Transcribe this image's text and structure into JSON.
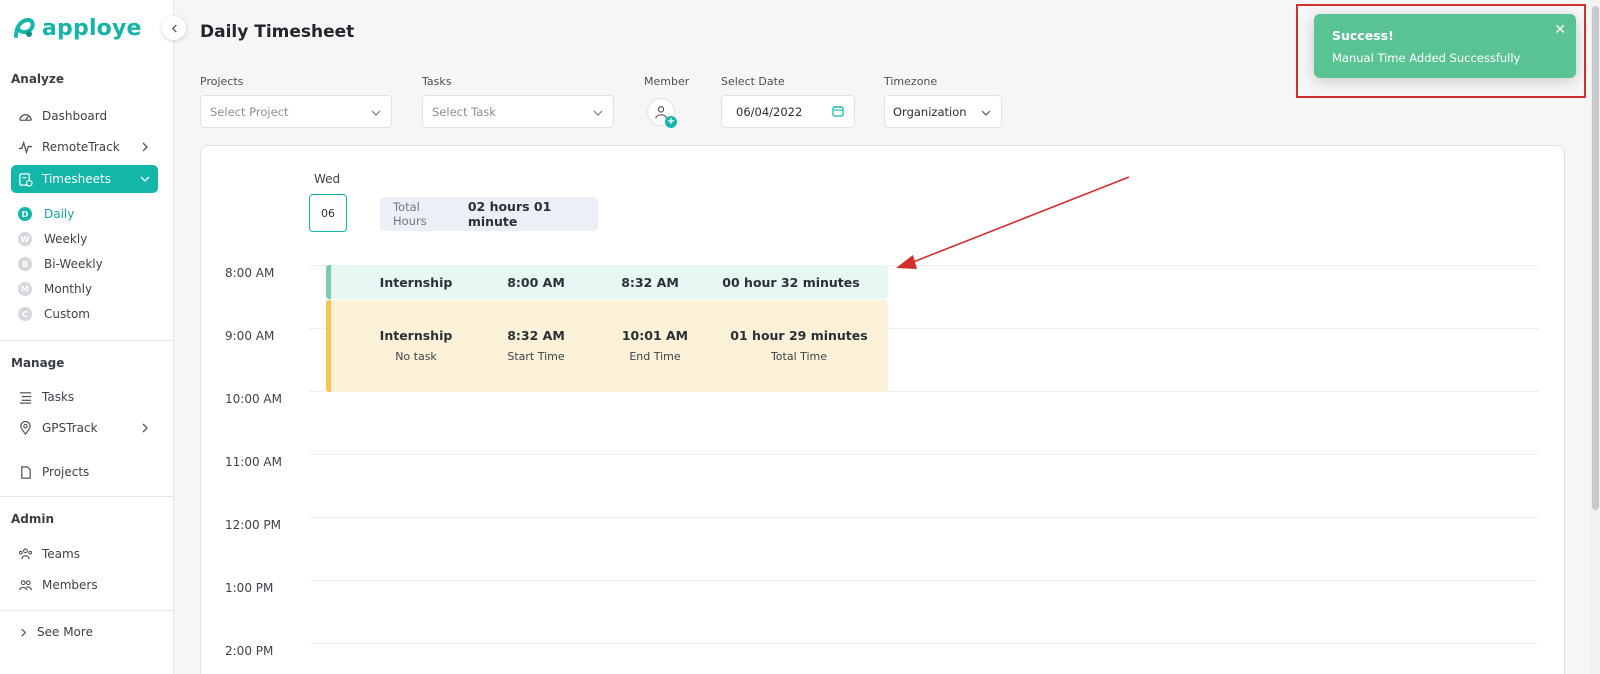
{
  "app": {
    "name": "apploye"
  },
  "sidebar": {
    "sections": {
      "analyze": "Analyze",
      "manage": "Manage",
      "admin": "Admin"
    },
    "items": {
      "dashboard": "Dashboard",
      "remotetrack": "RemoteTrack",
      "timesheets": "Timesheets",
      "tasks": "Tasks",
      "gpstrack": "GPSTrack",
      "projects": "Projects",
      "teams": "Teams",
      "members": "Members",
      "see_more": "See More"
    },
    "timesheet_views": [
      {
        "letter": "D",
        "label": "Daily"
      },
      {
        "letter": "W",
        "label": "Weekly"
      },
      {
        "letter": "B",
        "label": "Bi-Weekly"
      },
      {
        "letter": "M",
        "label": "Monthly"
      },
      {
        "letter": "C",
        "label": "Custom"
      }
    ]
  },
  "header": {
    "title": "Daily Timesheet",
    "filters": {
      "projects_label": "Projects",
      "projects_placeholder": "Select Project",
      "tasks_label": "Tasks",
      "tasks_placeholder": "Select Task",
      "member_label": "Member",
      "date_label": "Select Date",
      "date_value": "06/04/2022",
      "timezone_label": "Timezone",
      "timezone_value": "Organization"
    }
  },
  "day": {
    "name": "Wed",
    "number": "06",
    "total_hours_label": "Total Hours",
    "total_hours_value": "02 hours 01 minute"
  },
  "time_slots": [
    "8:00 AM",
    "9:00 AM",
    "10:00 AM",
    "11:00 AM",
    "12:00 PM",
    "1:00 PM",
    "2:00 PM"
  ],
  "entries": [
    {
      "project": "Internship",
      "start": "8:00 AM",
      "end": "8:32 AM",
      "total": "00 hour 32 minutes"
    },
    {
      "project": "Internship",
      "task": "No task",
      "start": "8:32 AM",
      "start_label": "Start Time",
      "end": "10:01 AM",
      "end_label": "End Time",
      "total": "01 hour 29 minutes",
      "total_label": "Total Time"
    }
  ],
  "toast": {
    "title": "Success!",
    "message": "Manual Time Added Successfully",
    "close": "✕"
  },
  "colors": {
    "brand": "#13b6a9",
    "toast": "#5ac393",
    "manual_entry": "#fbf1d9",
    "manual_bar": "#f4c64f",
    "entry_short": "#e6f7f4",
    "entry_short_bar": "#7ec8b6",
    "annotation": "#d22f2f"
  }
}
